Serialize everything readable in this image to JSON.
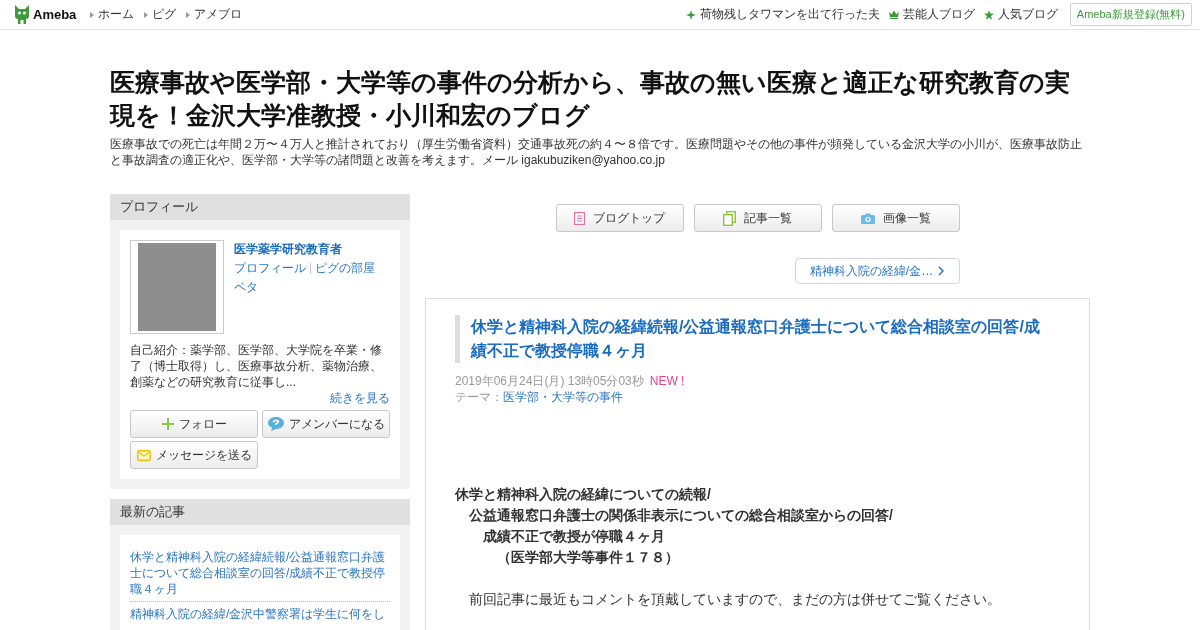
{
  "header": {
    "logo": "Ameba",
    "nav": [
      "ホーム",
      "ピグ",
      "アメブロ"
    ],
    "links": [
      {
        "kind": "sparkle",
        "label": "荷物残しタワマンを出て行った夫"
      },
      {
        "kind": "crown",
        "label": "芸能人ブログ"
      },
      {
        "kind": "star",
        "label": "人気ブログ"
      }
    ],
    "signup": "Ameba新規登録(無料)"
  },
  "blog": {
    "title": "医療事故や医学部・大学等の事件の分析から、事故の無い医療と適正な研究教育の実現を！金沢大学准教授・小川和宏のブログ",
    "description": "医療事故での死亡は年間２万〜４万人と推計されており（厚生労働省資料）交通事故死の約４〜８倍です。医療問題やその他の事件が頻発している金沢大学の小川が、医療事故防止と事故調査の適正化や、医学部・大学等の諸問題と改善を考えます。メール igakubuziken@yahoo.co.jp"
  },
  "sidebar": {
    "profile": {
      "heading": "プロフィール",
      "name": "医学薬学研究教育者",
      "links": [
        [
          "プロフィール",
          "ピグの部屋"
        ],
        [
          "ペタ"
        ]
      ],
      "intro": "自己紹介：薬学部、医学部、大学院を卒業・修了（博士取得）し、医療事故分析、薬物治療、創薬などの研究教育に従事し...",
      "more": "続きを見る",
      "buttons": [
        {
          "kind": "follow",
          "label": "フォロー"
        },
        {
          "kind": "amember",
          "label": "アメンバーになる"
        },
        {
          "kind": "message",
          "label": "メッセージを送る"
        }
      ]
    },
    "latest": {
      "heading": "最新の記事",
      "items": [
        "休学と精神科入院の経緯続報/公益通報窓口弁護士について総合相談室の回答/成績不正で教授停職４ヶ月",
        "精神科入院の経緯/金沢中警察署は学生に何をし"
      ]
    }
  },
  "main": {
    "nav": [
      {
        "kind": "top",
        "label": "ブログトップ"
      },
      {
        "kind": "list",
        "label": "記事一覧"
      },
      {
        "kind": "images",
        "label": "画像一覧"
      }
    ],
    "next": "精神科入院の経緯/金…",
    "article": {
      "title": "休学と精神科入院の経緯続報/公益通報窓口弁護士について総合相談室の回答/成績不正で教授停職４ヶ月",
      "date": "2019年06月24日(月) 13時05分03秒",
      "new_label": "NEW !",
      "theme_label": "テーマ：",
      "theme": "医学部・大学等の事件",
      "paragraphs": [
        {
          "bold": true,
          "lines": [
            "休学と精神科入院の経緯についての続報/",
            "　公益通報窓口弁護士の関係非表示についての総合相談室からの回答/",
            "　　成績不正で教授が停職４ヶ月",
            "　　　（医学部大学等事件１７８）"
          ]
        },
        {
          "bold": false,
          "lines": [
            "　前回記事に最近もコメントを頂戴していますので、まだの方は併せてご覧ください。"
          ]
        }
      ]
    }
  }
}
